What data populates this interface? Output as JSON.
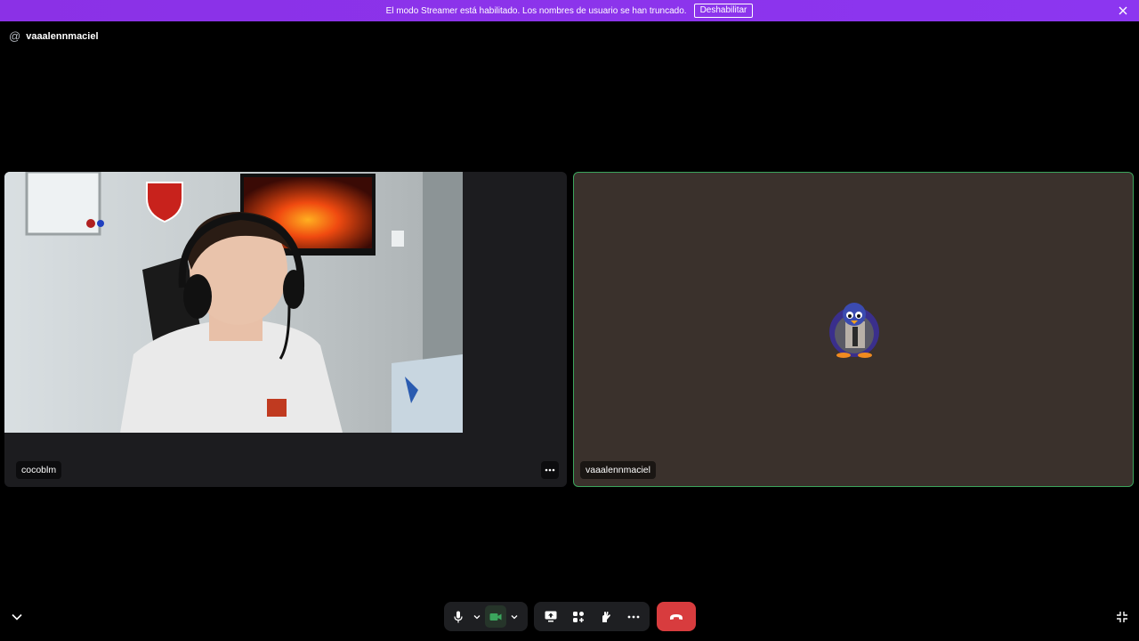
{
  "banner": {
    "message": "El modo Streamer está habilitado. Los nombres de usuario se han truncado.",
    "button_label": "Deshabilitar"
  },
  "header": {
    "channel_name": "vaaalennmaciel"
  },
  "tiles": [
    {
      "name": "cocoblm",
      "type": "camera"
    },
    {
      "name": "vaaalennmaciel",
      "type": "avatar",
      "speaking": true
    }
  ],
  "colors": {
    "banner": "#8b31e6",
    "hangup": "#d83c3e",
    "speaking_border": "#3ba55d",
    "right_tile_bg": "#3a312c"
  },
  "controls": {
    "icons": [
      "microphone-icon",
      "chevron-down-icon",
      "camera-icon",
      "chevron-down-icon",
      "screen-share-icon",
      "activities-icon",
      "soundboard-icon",
      "more-icon",
      "hangup-icon"
    ]
  }
}
